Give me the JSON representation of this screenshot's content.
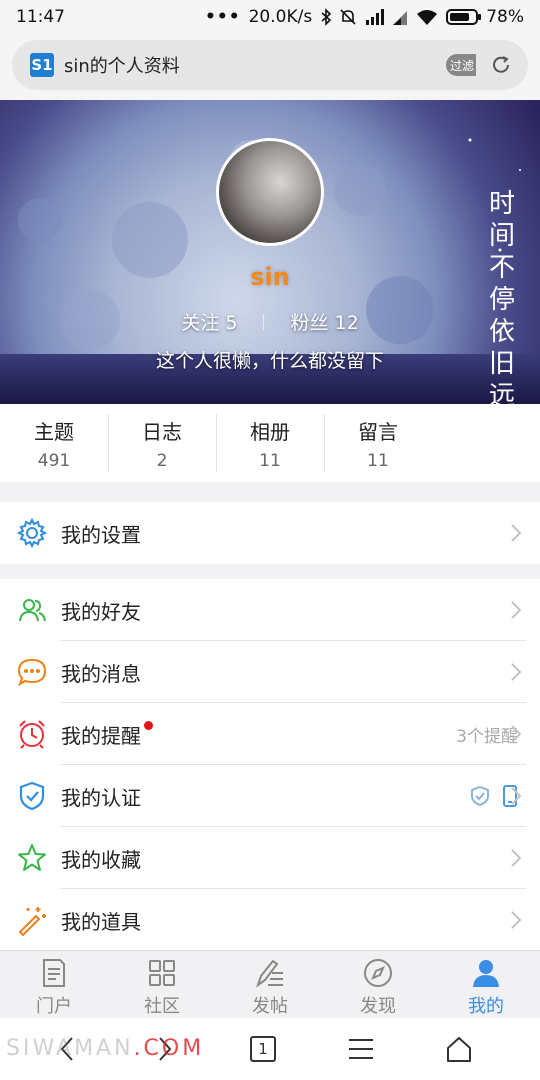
{
  "status_bar": {
    "time": "11:47",
    "dots": "•••",
    "speed": "20.0K/s",
    "battery": "78%",
    "battery_level": 0.78
  },
  "address_bar": {
    "favicon": "S1",
    "title": "sin的个人资料",
    "filter": "过滤"
  },
  "profile": {
    "username": "sin",
    "follow_label": "关注 5",
    "fans_label": "粉丝 12",
    "bio": "这个人很懒，什么都没留下",
    "banner_text": "时间不停依旧远行",
    "stats": [
      {
        "label": "主题",
        "value": "491"
      },
      {
        "label": "日志",
        "value": "2"
      },
      {
        "label": "相册",
        "value": "11"
      },
      {
        "label": "留言",
        "value": "11"
      }
    ]
  },
  "menu": {
    "settings": {
      "label": "我的设置",
      "icon": "gear-icon",
      "color": "#2f8ee0"
    },
    "items": [
      {
        "label": "我的好友",
        "icon": "friends-icon",
        "color": "#39b54a",
        "extra": ""
      },
      {
        "label": "我的消息",
        "icon": "message-icon",
        "color": "#f08119",
        "extra": ""
      },
      {
        "label": "我的提醒",
        "icon": "alarm-icon",
        "color": "#e8303a",
        "extra": "3个提醒"
      },
      {
        "label": "我的认证",
        "icon": "shield-icon",
        "color": "#2f8ee0",
        "extra": ""
      },
      {
        "label": "我的收藏",
        "icon": "star-icon",
        "color": "#39b54a",
        "extra": ""
      },
      {
        "label": "我的道具",
        "icon": "magic-wand-icon",
        "color": "#f08119",
        "extra": ""
      }
    ]
  },
  "tabbar": {
    "tabs": [
      {
        "label": "门户",
        "icon": "document-icon",
        "active": false
      },
      {
        "label": "社区",
        "icon": "grid-icon",
        "active": false
      },
      {
        "label": "发帖",
        "icon": "pen-icon",
        "active": false
      },
      {
        "label": "发现",
        "icon": "compass-icon",
        "active": false
      },
      {
        "label": "我的",
        "icon": "person-icon",
        "active": true
      }
    ],
    "active_color": "#3a8ee6"
  },
  "navbar": {
    "tab_count": "1"
  },
  "watermark": {
    "text_a": "SIWA",
    "text_b": "MAN",
    "text_c": ".COM"
  }
}
